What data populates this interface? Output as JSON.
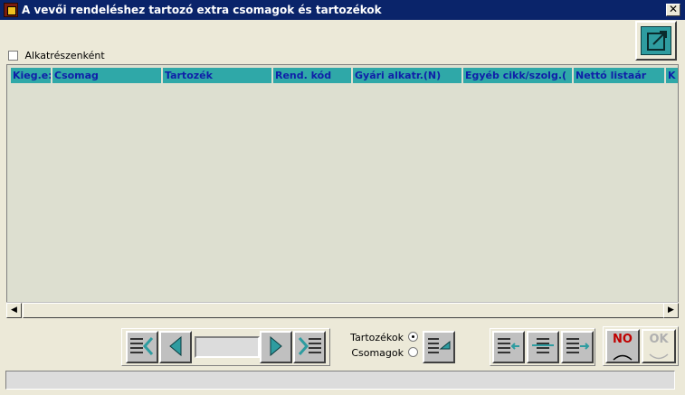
{
  "window": {
    "title": "A vevői rendeléshez tartozó extra csomagok és tartozékok",
    "close_label": "✕"
  },
  "options": {
    "checkbox_label": "Alkatrészenként",
    "checkbox_checked": false
  },
  "grid": {
    "columns": [
      "Kieg.e:",
      "Csomag",
      "Tartozék",
      "Rend. kód",
      "Gyári alkatr.(N)",
      "Egyéb cikk/szolg.(",
      "Nettó listaár",
      "K"
    ],
    "rows": [],
    "header_bg": "#2fa8a8",
    "header_text": "#1020a8"
  },
  "navigation": {
    "first_icon": "first-record-icon",
    "prev_icon": "prev-record-icon",
    "position_value": "",
    "next_icon": "next-record-icon",
    "last_icon": "last-record-icon"
  },
  "mode": {
    "option1": "Tartozékok",
    "option2": "Csomagok",
    "selected": "Tartozékok"
  },
  "actions": {
    "no_label": "NO",
    "ok_label": "OK"
  },
  "status": {
    "text": ""
  },
  "colors": {
    "titlebar": "#0a246a",
    "accent": "#2e9ca0",
    "no_text": "#c00000"
  }
}
